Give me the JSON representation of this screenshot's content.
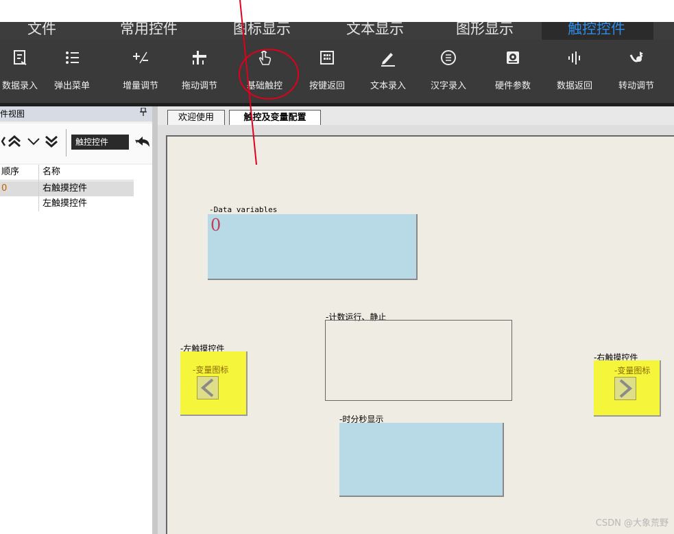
{
  "menu": {
    "items": [
      {
        "label": "文件"
      },
      {
        "label": "常用控件"
      },
      {
        "label": "图标显示"
      },
      {
        "label": "文本显示"
      },
      {
        "label": "图形显示"
      },
      {
        "label": "触控控件"
      }
    ]
  },
  "toolbar": {
    "items": [
      {
        "label": "数据录入",
        "icon": "data-entry-icon"
      },
      {
        "label": "弹出菜单",
        "icon": "popup-menu-icon"
      },
      {
        "label": "增量调节",
        "icon": "increment-icon"
      },
      {
        "label": "拖动调节",
        "icon": "drag-slider-icon"
      },
      {
        "label": "基础触控",
        "icon": "touch-hand-icon"
      },
      {
        "label": "按键返回",
        "icon": "keypad-icon"
      },
      {
        "label": "文本录入",
        "icon": "pencil-icon"
      },
      {
        "label": "汉字录入",
        "icon": "text-circle-icon"
      },
      {
        "label": "硬件参数",
        "icon": "hardware-icon"
      },
      {
        "label": "数据返回",
        "icon": "waveform-icon"
      },
      {
        "label": "转动调节",
        "icon": "rotate-icon"
      }
    ]
  },
  "left_panel": {
    "title": "件视图",
    "pin": "ꟸ",
    "combo_value": "触控控件",
    "columns": [
      "顺序",
      "名称"
    ],
    "rows": [
      {
        "order": "0",
        "name": "右触摸控件"
      },
      {
        "order": "",
        "name": "左触摸控件"
      }
    ]
  },
  "tabs": [
    {
      "label": "欢迎使用"
    },
    {
      "label": "触控及变量配置"
    }
  ],
  "canvas": {
    "data_var_label": "-Data variables",
    "data_var_value": "0",
    "count_label": "-计数运行、静止",
    "left_touch_label": "-左触摸控件",
    "left_var_icon_label": "-变量图标",
    "right_touch_label": "-右触摸控件",
    "right_var_icon_label": "-变量图标",
    "time_label": "-时分秒显示"
  },
  "watermark": "CSDN @大象荒野",
  "colors": {
    "ribbon_bg": "#3a3a3a",
    "active_menu": "#2f8ce6",
    "canvas_bg": "#efece4",
    "blue_box": "#b8dae6",
    "yellow_box": "#f5f53c",
    "annotation_red": "#e0001b"
  }
}
